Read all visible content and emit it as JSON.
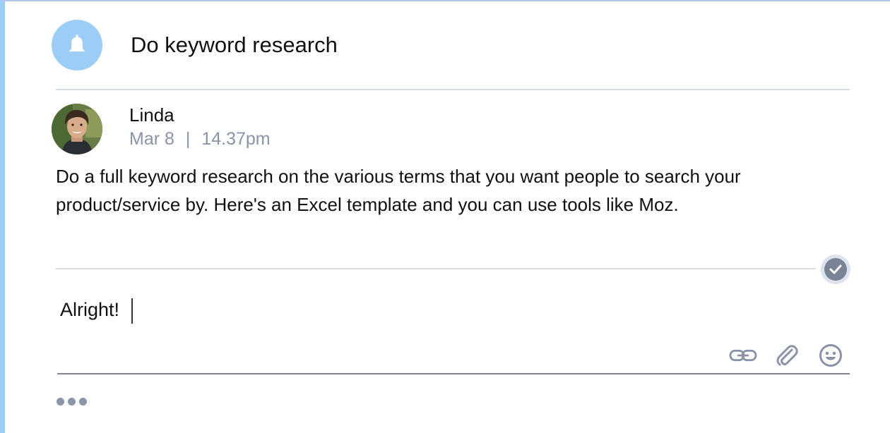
{
  "task": {
    "title": "Do keyword research",
    "icon": "bell-icon"
  },
  "comment": {
    "author": "Linda",
    "date": "Mar 8",
    "separator": "|",
    "time": "14.37pm",
    "text": "Do a full keyword research on the various terms that you want people to search your product/service by. Here's an Excel template and you can use tools like Moz.",
    "status_icon": "check-icon"
  },
  "reply": {
    "value": "Alright!",
    "tools": [
      "link-icon",
      "paperclip-icon",
      "emoji-icon"
    ]
  },
  "footer": {
    "more_icon": "more-dots-icon"
  },
  "colors": {
    "accent_blue": "#9ccdf7",
    "muted_text": "#8a93a8",
    "check_gray": "#7a8396",
    "divider": "#d9dde3"
  }
}
